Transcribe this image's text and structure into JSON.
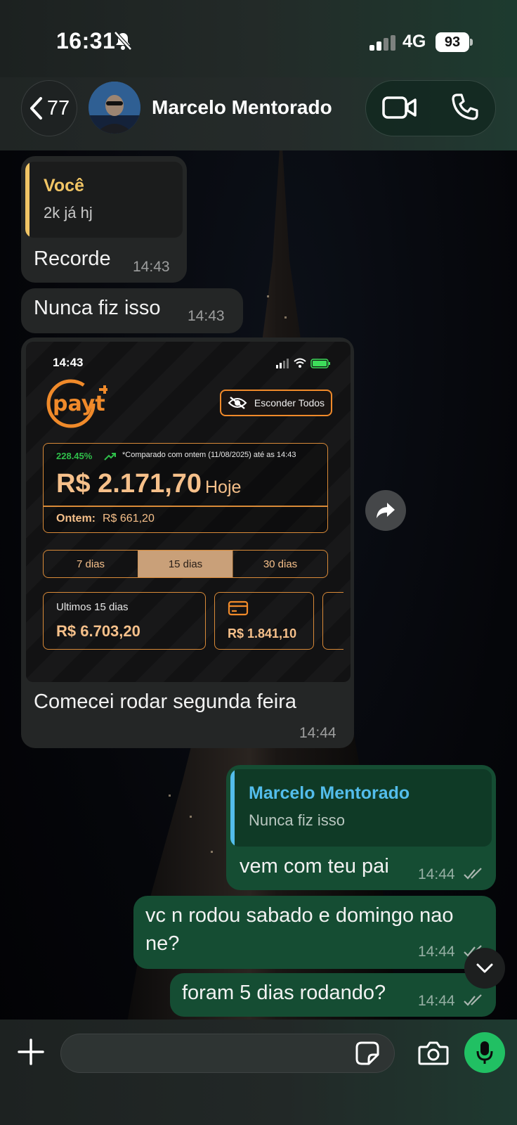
{
  "status_bar": {
    "time": "16:31",
    "network": "4G",
    "battery": "93"
  },
  "header": {
    "back_count": "77",
    "contact_name": "Marcelo Mentorado"
  },
  "messages": [
    {
      "id": "m1",
      "direction": "incoming",
      "reply_to": {
        "author": "Você",
        "text": "2k já hj"
      },
      "text": "Recorde",
      "time": "14:43"
    },
    {
      "id": "m2",
      "direction": "incoming",
      "text": "Nunca fiz isso",
      "time": "14:43"
    },
    {
      "id": "m3",
      "direction": "incoming",
      "type": "image",
      "caption": "Comecei rodar segunda feira",
      "time": "14:44",
      "screenshot": {
        "time": "14:43",
        "logo": "payt",
        "hide_all_label": "Esconder Todos",
        "change_percent": "228.45%",
        "compare_note": "*Comparado com ontem (11/08/2025) até as 14:43",
        "today_value": "R$ 2.171,70",
        "today_label": "Hoje",
        "yesterday_label": "Ontem:",
        "yesterday_value": "R$ 661,20",
        "periods": [
          "7 dias",
          "15 dias",
          "30 dias"
        ],
        "active_period": "15 dias",
        "last15_label": "Ultimos 15 dias",
        "last15_value": "R$ 6.703,20",
        "card_value": "R$ 1.841,10"
      }
    },
    {
      "id": "m4",
      "direction": "outgoing",
      "reply_to": {
        "author": "Marcelo Mentorado",
        "text": "Nunca fiz isso"
      },
      "text": "vem com teu pai",
      "time": "14:44",
      "status": "read"
    },
    {
      "id": "m5",
      "direction": "outgoing",
      "text_line1": "vc n rodou sabado e domingo nao",
      "text_line2": "ne?",
      "time": "14:44",
      "status": "read"
    },
    {
      "id": "m6",
      "direction": "outgoing",
      "text": "foram 5 dias rodando?",
      "time": "14:44",
      "status": "read"
    }
  ],
  "colors": {
    "incoming_bubble": "#242626",
    "outgoing_bubble": "#154d33",
    "accent_green": "#21c063",
    "payt_orange": "#f08a2a",
    "quote_you": "#f1c565",
    "quote_contact": "#53bdeb"
  },
  "icons": {
    "header": [
      "chevron-left-icon",
      "video-camera-icon",
      "phone-icon"
    ],
    "composer": [
      "plus-icon",
      "sticker-icon",
      "camera-icon",
      "microphone-icon"
    ],
    "misc": [
      "forward-icon",
      "chevron-down-icon",
      "bell-slash-icon",
      "double-check-icon"
    ]
  }
}
